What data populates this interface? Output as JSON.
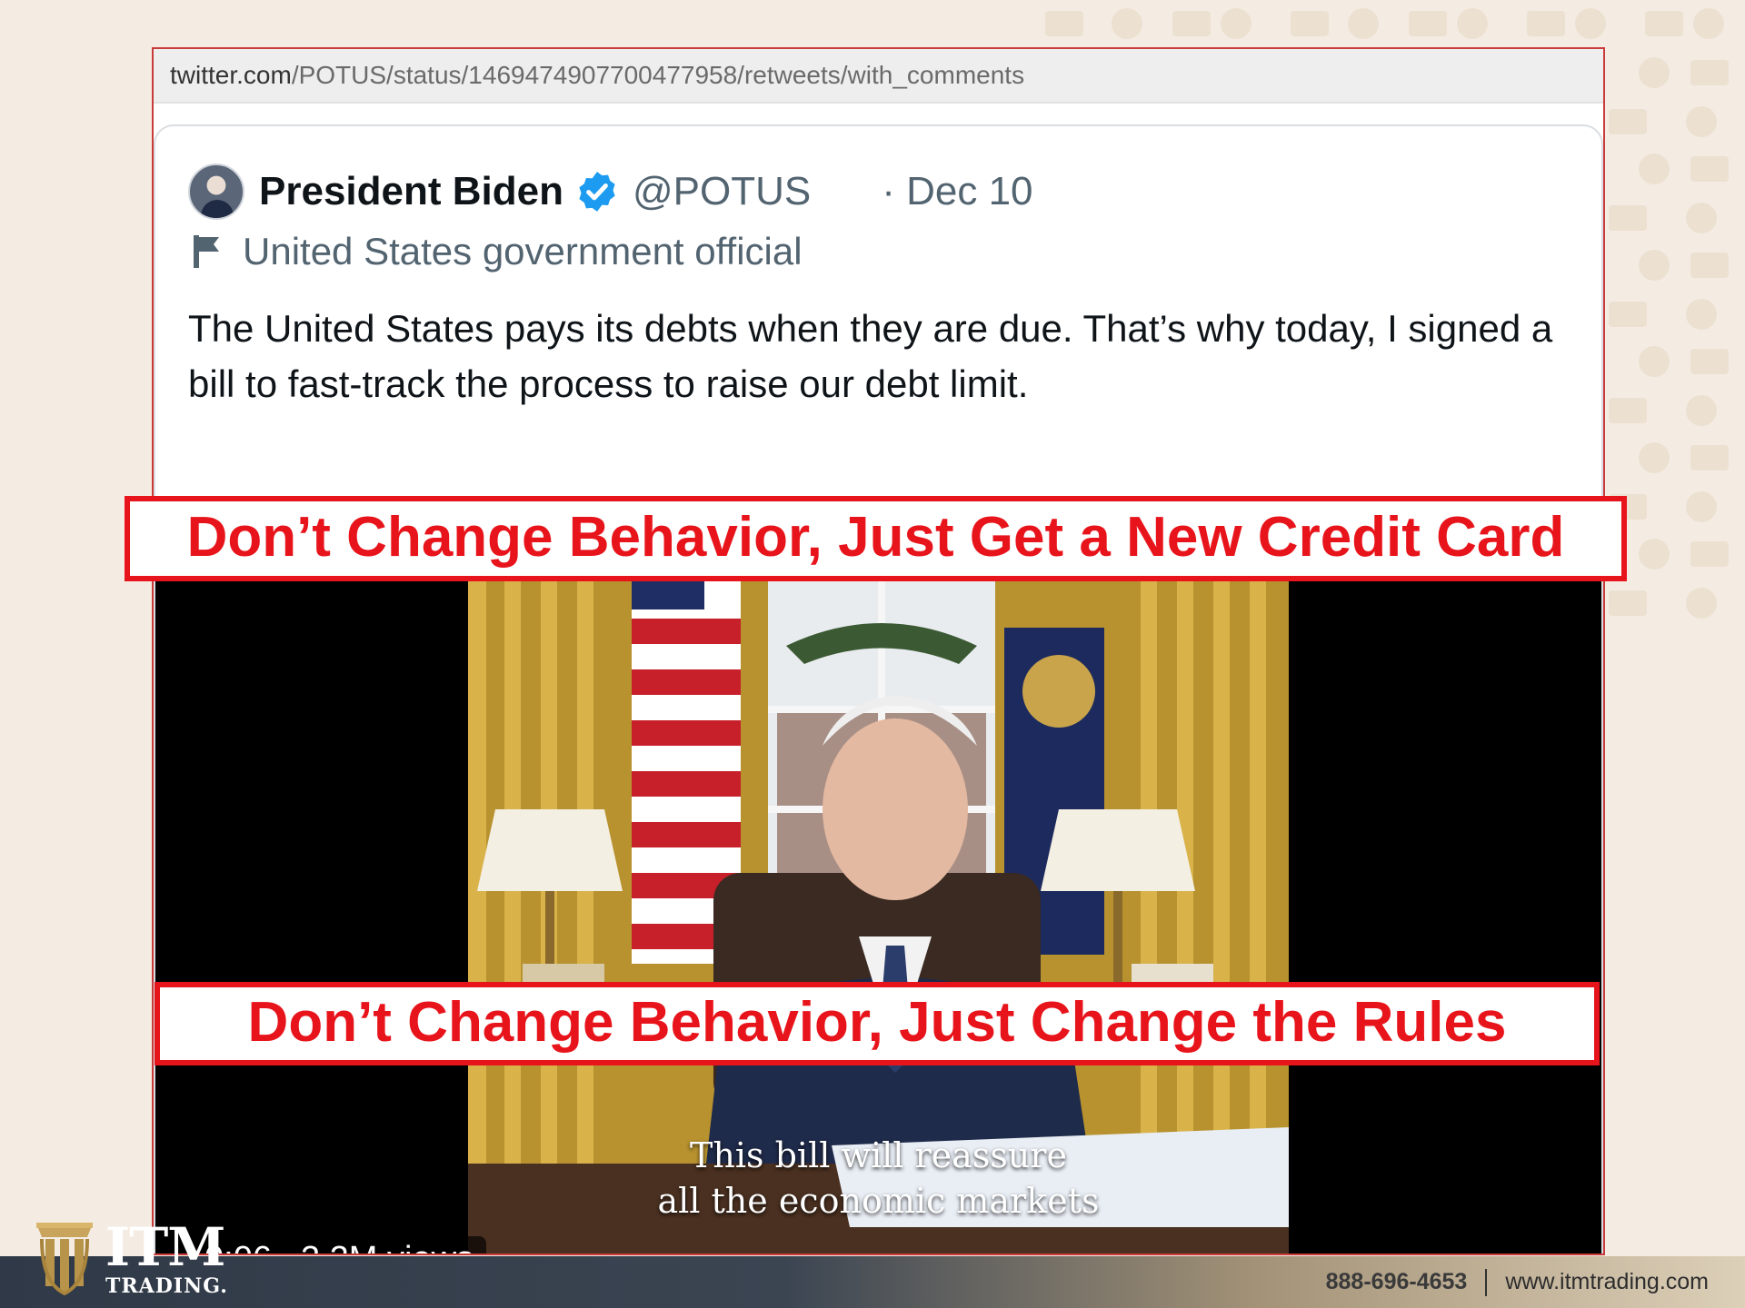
{
  "url": {
    "host": "twitter.com",
    "path": "/POTUS/status/1469474907700477958/retweets/with_comments"
  },
  "tweet": {
    "author_name": "President Biden",
    "handle": "@POTUS",
    "date": "· Dec 10",
    "label": "United States government official",
    "text": "The United States pays its debts when they are due. That’s why today, I signed a bill to fast-track the process to raise our debt limit."
  },
  "video": {
    "caption_line1": "This bill will reassure",
    "caption_line2": "all the economic markets",
    "time": "0:06",
    "views": "3.2M views"
  },
  "overlays": {
    "top": "Don’t Change Behavior, Just Get a New Credit Card",
    "bottom": "Don’t Change Behavior, Just Change the Rules"
  },
  "footer": {
    "phone": "888-696-4653",
    "website": "www.itmtrading.com",
    "logo_text": "ITM",
    "logo_subtext": "TRADING."
  },
  "colors": {
    "accent_red": "#e8141b",
    "verified_blue": "#1d9bf0",
    "logo_gold": "#b8934a"
  },
  "icons": [
    "verified-badge-icon",
    "flag-icon",
    "itm-pillar-logo-icon"
  ]
}
